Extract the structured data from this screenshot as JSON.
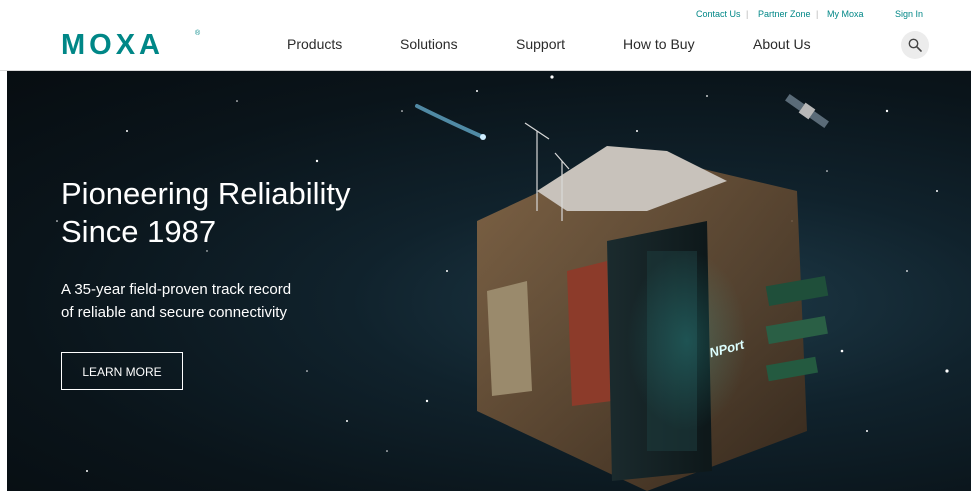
{
  "brand": {
    "logo_text": "MOXA",
    "registered_mark": "®"
  },
  "utility_links": [
    "Contact Us",
    "Partner Zone",
    "My Moxa",
    "Sign In"
  ],
  "nav": [
    "Products",
    "Solutions",
    "Support",
    "How to Buy",
    "About Us"
  ],
  "search": {
    "icon": "search-icon"
  },
  "hero": {
    "headline_line1": "Pioneering Reliability",
    "headline_line2": "Since 1987",
    "sub_line1": "A 35-year field-proven track record",
    "sub_line2": "of reliable and secure connectivity",
    "cta_label": "LEARN MORE",
    "product_label": "NPort"
  },
  "colors": {
    "brand_teal": "#008787",
    "nav_text": "#2b2b2b",
    "hero_bg": "#0a141a",
    "product_glow": "#3ee8e0"
  }
}
